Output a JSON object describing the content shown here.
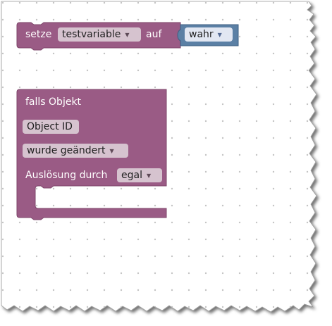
{
  "blocks": {
    "set_block": {
      "keyword_set": "setze",
      "variable": "testvariable",
      "keyword_to": "auf",
      "value": "wahr"
    },
    "trigger_block": {
      "title": "falls Objekt",
      "object_id_field": "Object ID",
      "condition": "wurde geändert",
      "trigger_label": "Auslösung durch",
      "trigger_value": "egal"
    }
  },
  "icons": {
    "dropdown": "dropdown-arrow-icon"
  },
  "colors": {
    "block_purple": "#9a5b85",
    "block_purple_dark": "#7d4569",
    "block_blue": "#5b80a5",
    "pill_purple": "#d6c3cf",
    "pill_blue": "#e2e7f2",
    "grid_dot": "#bdbdbd"
  }
}
